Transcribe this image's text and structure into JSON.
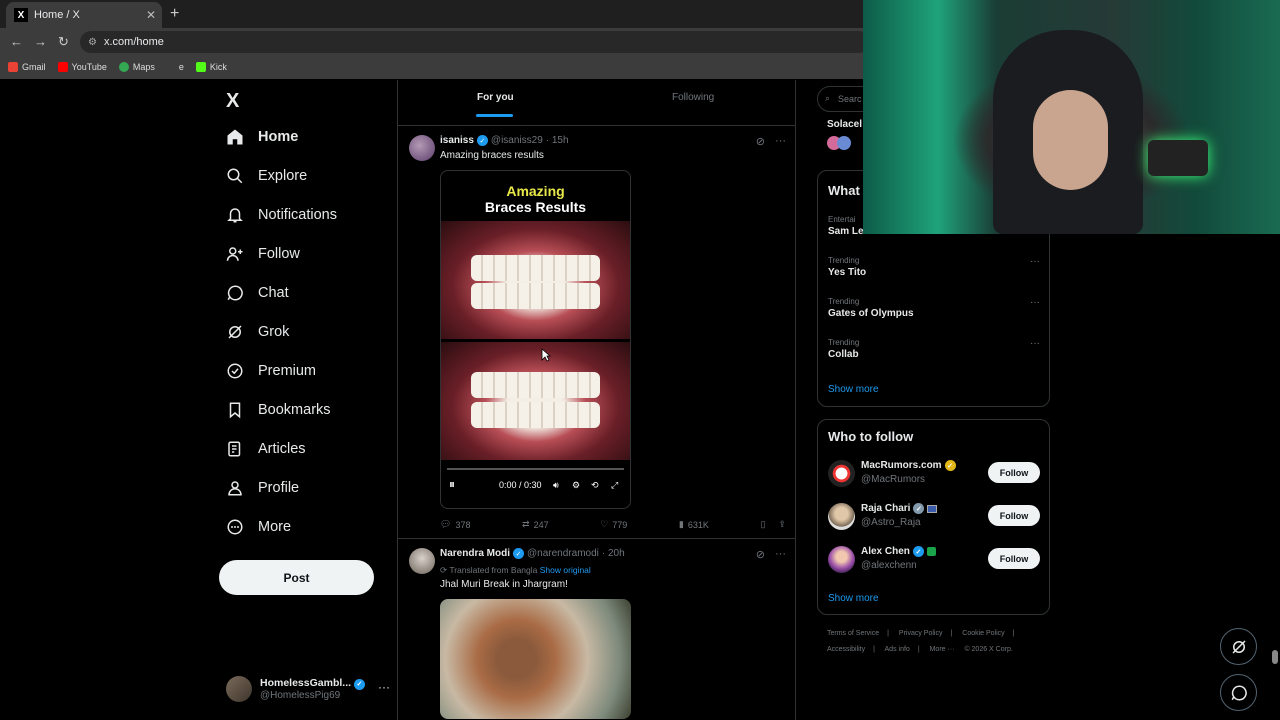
{
  "browser": {
    "tab_title": "Home / X",
    "tab_favicon": "X",
    "url": "x.com/home",
    "bookmarks": [
      {
        "label": "Gmail",
        "color": "#ea4335"
      },
      {
        "label": "YouTube",
        "color": "#ff0000"
      },
      {
        "label": "Maps",
        "color": "#34a853"
      },
      {
        "label": "e",
        "color": "#555555"
      },
      {
        "label": "Kick",
        "color": "#53fc18"
      }
    ]
  },
  "sidebar": {
    "logo": "X",
    "items": [
      {
        "label": "Home",
        "icon": "home-icon"
      },
      {
        "label": "Explore",
        "icon": "search-icon"
      },
      {
        "label": "Notifications",
        "icon": "bell-icon"
      },
      {
        "label": "Follow",
        "icon": "person-plus-icon"
      },
      {
        "label": "Chat",
        "icon": "chat-bubble-icon"
      },
      {
        "label": "Grok",
        "icon": "grok-icon"
      },
      {
        "label": "Premium",
        "icon": "premium-icon"
      },
      {
        "label": "Bookmarks",
        "icon": "bookmark-icon"
      },
      {
        "label": "Articles",
        "icon": "articles-icon"
      },
      {
        "label": "Profile",
        "icon": "person-icon"
      },
      {
        "label": "More",
        "icon": "more-circle-icon"
      }
    ],
    "post_label": "Post",
    "account": {
      "name": "HomelessGambl...",
      "handle": "@HomelessPig69"
    }
  },
  "feed": {
    "tabs": [
      {
        "label": "For you"
      },
      {
        "label": "Following"
      }
    ],
    "tweets": [
      {
        "name": "isaniss",
        "handle": "@isaniss29",
        "time": "· 15h",
        "text": "Amazing braces results",
        "media_title_1": "Amazing",
        "media_title_2": "Braces Results",
        "video_time": "0:00 / 0:30",
        "replies": "378",
        "reposts": "247",
        "likes": "779",
        "views": "631K"
      },
      {
        "name": "Narendra Modi",
        "handle": "@narendramodi",
        "time": "· 20h",
        "translated": "Translated from Bangla",
        "show_original": "Show original",
        "text": "Jhal Muri Break in Jhargram!"
      }
    ]
  },
  "right": {
    "search_placeholder": "Searc",
    "partial_trend": "Solacel",
    "whats_happening_title": "What",
    "trends": [
      {
        "category": "Entertai",
        "name": "Sam Levinson"
      },
      {
        "category": "Trending",
        "name": "Yes Tito"
      },
      {
        "category": "Trending",
        "name": "Gates of Olympus"
      },
      {
        "category": "Trending",
        "name": "Collab"
      }
    ],
    "show_more": "Show more",
    "who_to_follow_title": "Who to follow",
    "follow_suggestions": [
      {
        "name": "MacRumors.com",
        "handle": "@MacRumors",
        "badge": "gold"
      },
      {
        "name": "Raja Chari",
        "handle": "@Astro_Raja",
        "badge": "grey"
      },
      {
        "name": "Alex Chen",
        "handle": "@alexchenn",
        "badge": "blue"
      }
    ],
    "follow_label": "Follow",
    "footer_links": [
      "Terms of Service",
      "|",
      "Privacy Policy",
      "|",
      "Cookie Policy",
      "|",
      "Accessibility",
      "|",
      "Ads info",
      "|",
      "More ···",
      "© 2026 X Corp."
    ]
  },
  "colors": {
    "accent": "#1d9bf0",
    "border": "#2f3336",
    "muted": "#71767b"
  }
}
